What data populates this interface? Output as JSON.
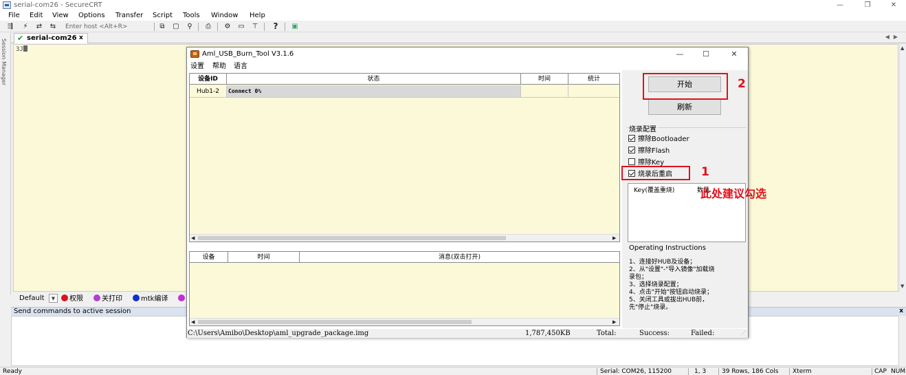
{
  "crt": {
    "title": "serial-com26 - SecureCRT",
    "menu": [
      "File",
      "Edit",
      "View",
      "Options",
      "Transfer",
      "Script",
      "Tools",
      "Window",
      "Help"
    ],
    "toolbar": {
      "host_placeholder": "Enter host <Alt+R>",
      "help_label": "?"
    },
    "session_manager_label": "Session Manager",
    "tab": {
      "label": "serial-com26",
      "close": "x"
    },
    "terminal": {
      "prompt": "3J"
    },
    "button_bar": {
      "combo": "Default",
      "items": [
        {
          "label": "权限",
          "color": "#d8141a"
        },
        {
          "label": "关打印",
          "color": "#b040d0"
        },
        {
          "label": "mtk编译",
          "color": "#1030d0"
        }
      ]
    },
    "command_window": {
      "label": "Send commands to active session",
      "close": "x"
    },
    "status": {
      "ready": "Ready",
      "serial": "Serial: COM26, 115200",
      "cursor": "1,   3",
      "size": "39 Rows, 186 Cols",
      "term": "Xterm",
      "cap": "CAP",
      "num": "NUM"
    }
  },
  "burn_tool": {
    "title": "Aml_USB_Burn_Tool V3.1.6",
    "menu": [
      "设置",
      "帮助",
      "语言"
    ],
    "device_table": {
      "headers": [
        "设备ID",
        "状态",
        "时间",
        "统计"
      ],
      "rows": [
        {
          "device_id": "Hub1-2",
          "status": "Connect 0%",
          "progress": 0,
          "time": "",
          "stats": ""
        }
      ]
    },
    "log_table": {
      "headers": [
        "设备",
        "时间",
        "消息(双击打开)"
      ]
    },
    "buttons": {
      "start": "开始",
      "refresh": "刷新"
    },
    "burn_config": {
      "title": "烧录配置",
      "options": [
        {
          "label": "擦除Bootloader",
          "checked": true
        },
        {
          "label": "擦除Flash",
          "checked": true
        },
        {
          "label": "擦除Key",
          "checked": false
        },
        {
          "label": "烧录后重启",
          "checked": true
        }
      ]
    },
    "key_list": {
      "col_key": "Key(覆盖重烧)",
      "col_count": "数量"
    },
    "instructions": {
      "title": "Operating Instructions",
      "lines": [
        "1、连接好HUB及设备；",
        "2、从\"设置\"-\"导入镜像\"加载烧",
        "录包；",
        "3、选择烧录配置；",
        "4、点击\"开始\"按钮启动烧录；",
        "5、关闭工具或拔出HUB前，",
        "先\"停止\"烧录。"
      ]
    },
    "footer": {
      "path": "C:\\Users\\Amibo\\Desktop\\aml_upgrade_package.img",
      "size": "1,787,450KB",
      "total": "Total:",
      "success": "Success:",
      "failed": "Failed:"
    }
  },
  "annotations": {
    "num1": "1",
    "num2": "2",
    "note": "此处建议勾选",
    "color": "#e0101a"
  }
}
